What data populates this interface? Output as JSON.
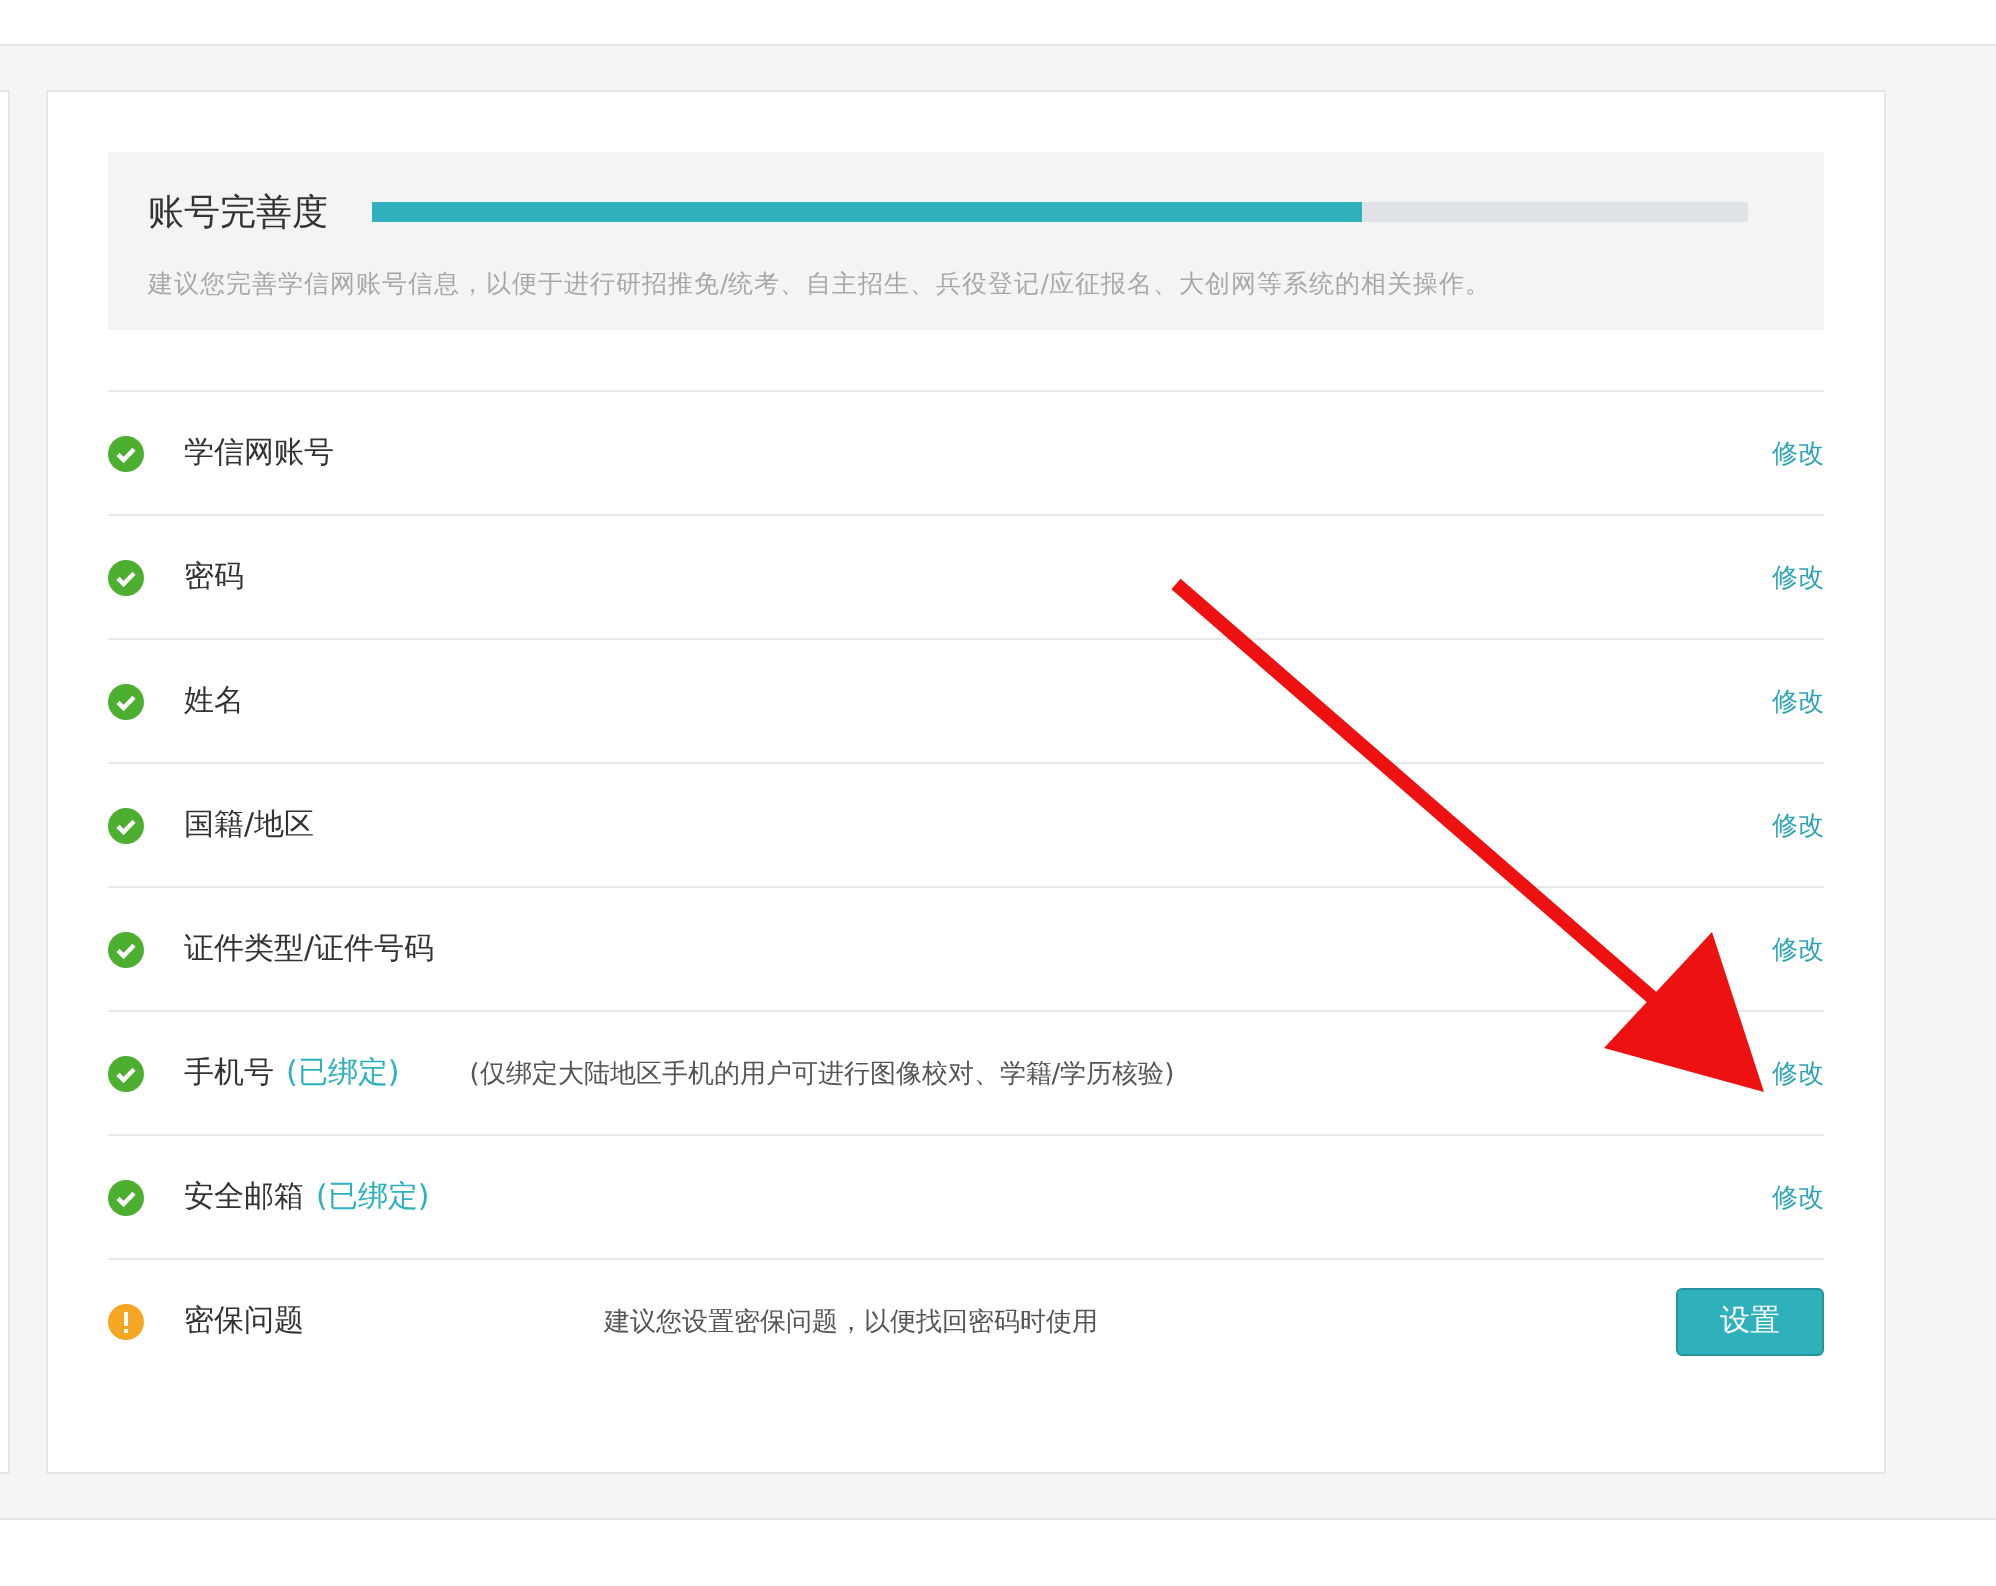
{
  "completeness": {
    "title": "账号完善度",
    "level": 0.72,
    "hint": "建议您完善学信网账号信息，以便于进行研招推免/统考、自主招生、兵役登记/应征报名、大创网等系统的相关操作。"
  },
  "items": [
    {
      "label": "学信网账号",
      "kind": "ok",
      "action": {
        "kind": "link",
        "label": "修改"
      }
    },
    {
      "label": "密码",
      "kind": "ok",
      "action": {
        "kind": "link",
        "label": "修改"
      }
    },
    {
      "label": "姓名",
      "kind": "ok",
      "action": {
        "kind": "link",
        "label": "修改"
      }
    },
    {
      "label": "国籍/地区",
      "kind": "ok",
      "action": {
        "kind": "link",
        "label": "修改"
      }
    },
    {
      "label": "证件类型/证件号码",
      "kind": "ok",
      "action": {
        "kind": "link",
        "label": "修改"
      }
    },
    {
      "label": "手机号",
      "tag": "(已绑定)",
      "kind": "ok",
      "note": "(仅绑定大陆地区手机的用户可进行图像校对、学籍/学历核验)",
      "action": {
        "kind": "link",
        "label": "修改"
      }
    },
    {
      "label": "安全邮箱",
      "tag": "(已绑定)",
      "kind": "ok",
      "action": {
        "kind": "link",
        "label": "修改"
      }
    },
    {
      "label": "密保问题",
      "kind": "warn",
      "note": "建议您设置密保问题，以便找回密码时使用",
      "action": {
        "kind": "button",
        "label": "设置"
      }
    }
  ]
}
